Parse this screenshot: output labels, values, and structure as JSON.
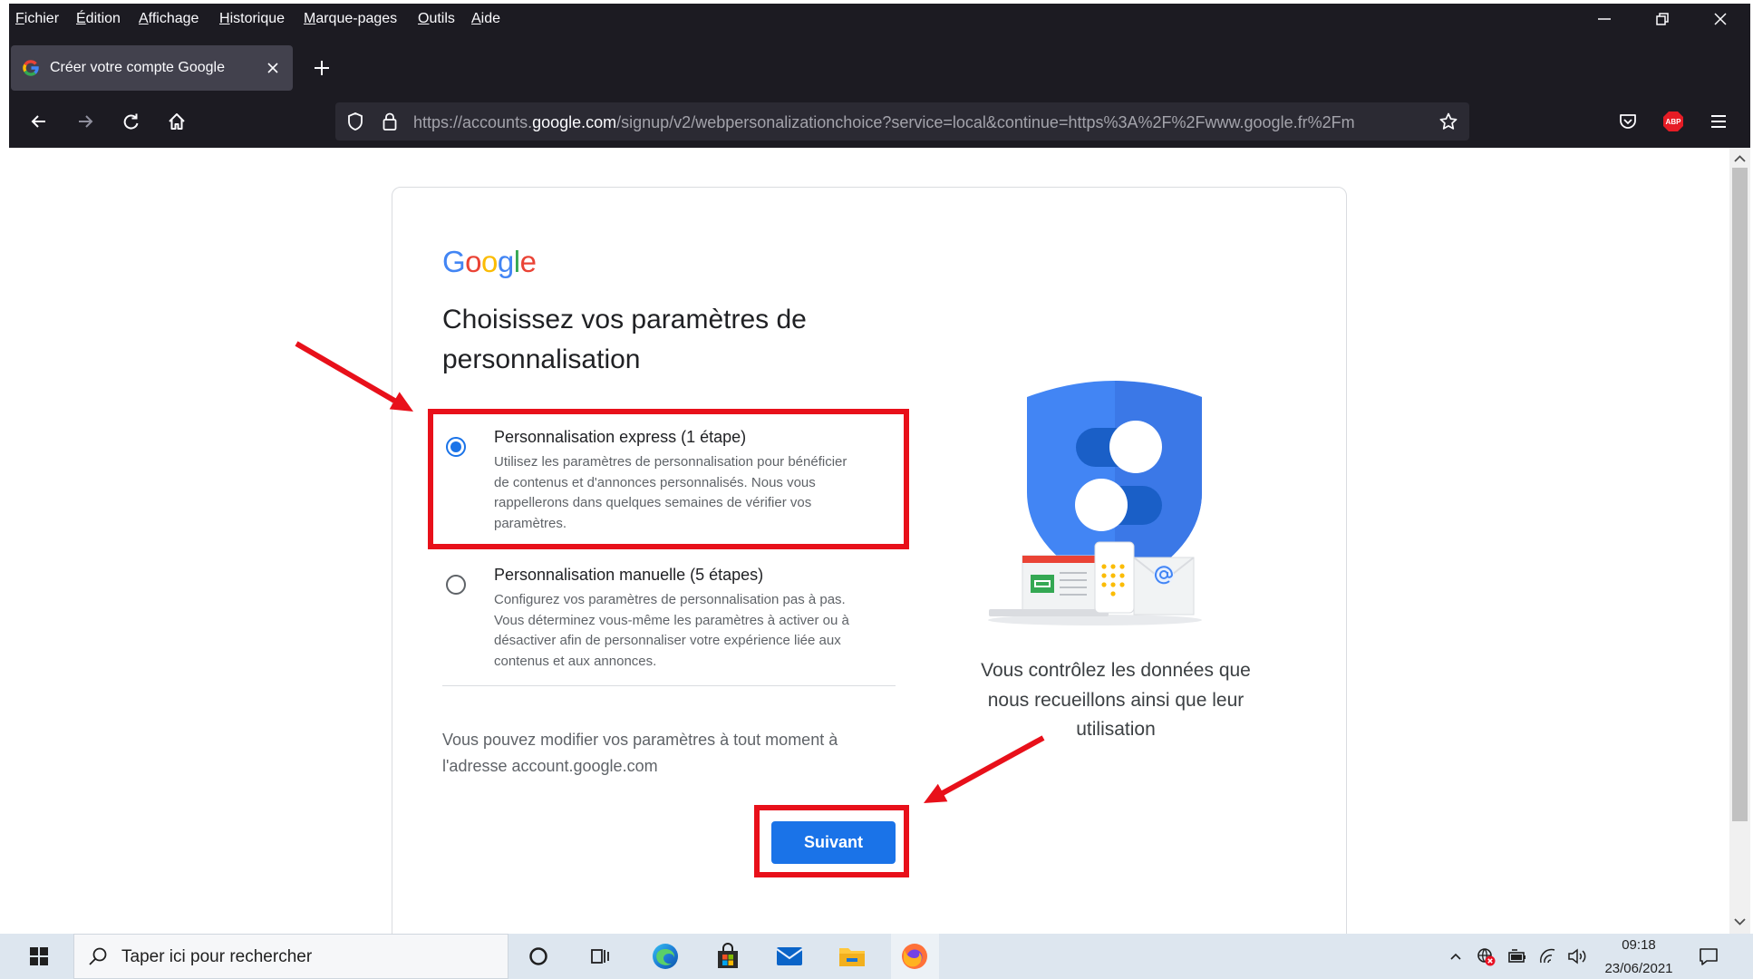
{
  "browser": {
    "menu": [
      "Fichier",
      "Édition",
      "Affichage",
      "Historique",
      "Marque-pages",
      "Outils",
      "Aide"
    ],
    "tab": {
      "title": "Créer votre compte Google"
    },
    "address_bar": {
      "url_prefix": "https://accounts.",
      "url_domain": "google.com",
      "url_suffix": "/signup/v2/webpersonalizationchoice?service=local&continue=https%3A%2F%2Fwww.google.fr%2Fm"
    },
    "toolbar": {
      "abp_badge": "ABP"
    },
    "icons": [
      "back-icon",
      "forward-icon",
      "reload-icon",
      "home-icon",
      "shield-icon",
      "lock-icon",
      "star-icon",
      "pocket-icon",
      "adblock-icon",
      "hamburger-menu-icon"
    ]
  },
  "page": {
    "logo": "Google",
    "logo_colors": [
      "#4285f4",
      "#ea4335",
      "#fbbc05",
      "#4285f4",
      "#34a853",
      "#ea4335"
    ],
    "heading_lines": [
      "Choisissez vos paramètres de",
      "personnalisation"
    ],
    "options": [
      {
        "title": "Personnalisation express (1 étape)",
        "description_lines": [
          "Utilisez les paramètres de personnalisation pour bénéficier",
          "de contenus et d'annonces personnalisés. Nous vous",
          "rappellerons dans quelques semaines de vérifier vos",
          "paramètres."
        ],
        "selected": true
      },
      {
        "title": "Personnalisation manuelle (5 étapes)",
        "description_lines": [
          "Configurez vos paramètres de personnalisation pas à pas.",
          "Vous déterminez vous-même les paramètres à activer ou à",
          "désactiver afin de personnaliser votre expérience liée aux",
          "contenus et aux annonces."
        ],
        "selected": false
      }
    ],
    "footer_note_lines": [
      "Vous pouvez modifier vos paramètres à tout moment à",
      "l'adresse account.google.com"
    ],
    "next_button": "Suivant",
    "caption_lines": [
      "Vous contrôlez les données que",
      "nous recueillons ainsi que leur",
      "utilisation"
    ]
  },
  "taskbar": {
    "search_placeholder": "Taper ici pour rechercher",
    "time": "09:18",
    "date": "23/06/2021"
  },
  "colors": {
    "accent": "#1a73e8",
    "annotation_red": "#e8101a",
    "browser_dark": "#1c1b22"
  }
}
